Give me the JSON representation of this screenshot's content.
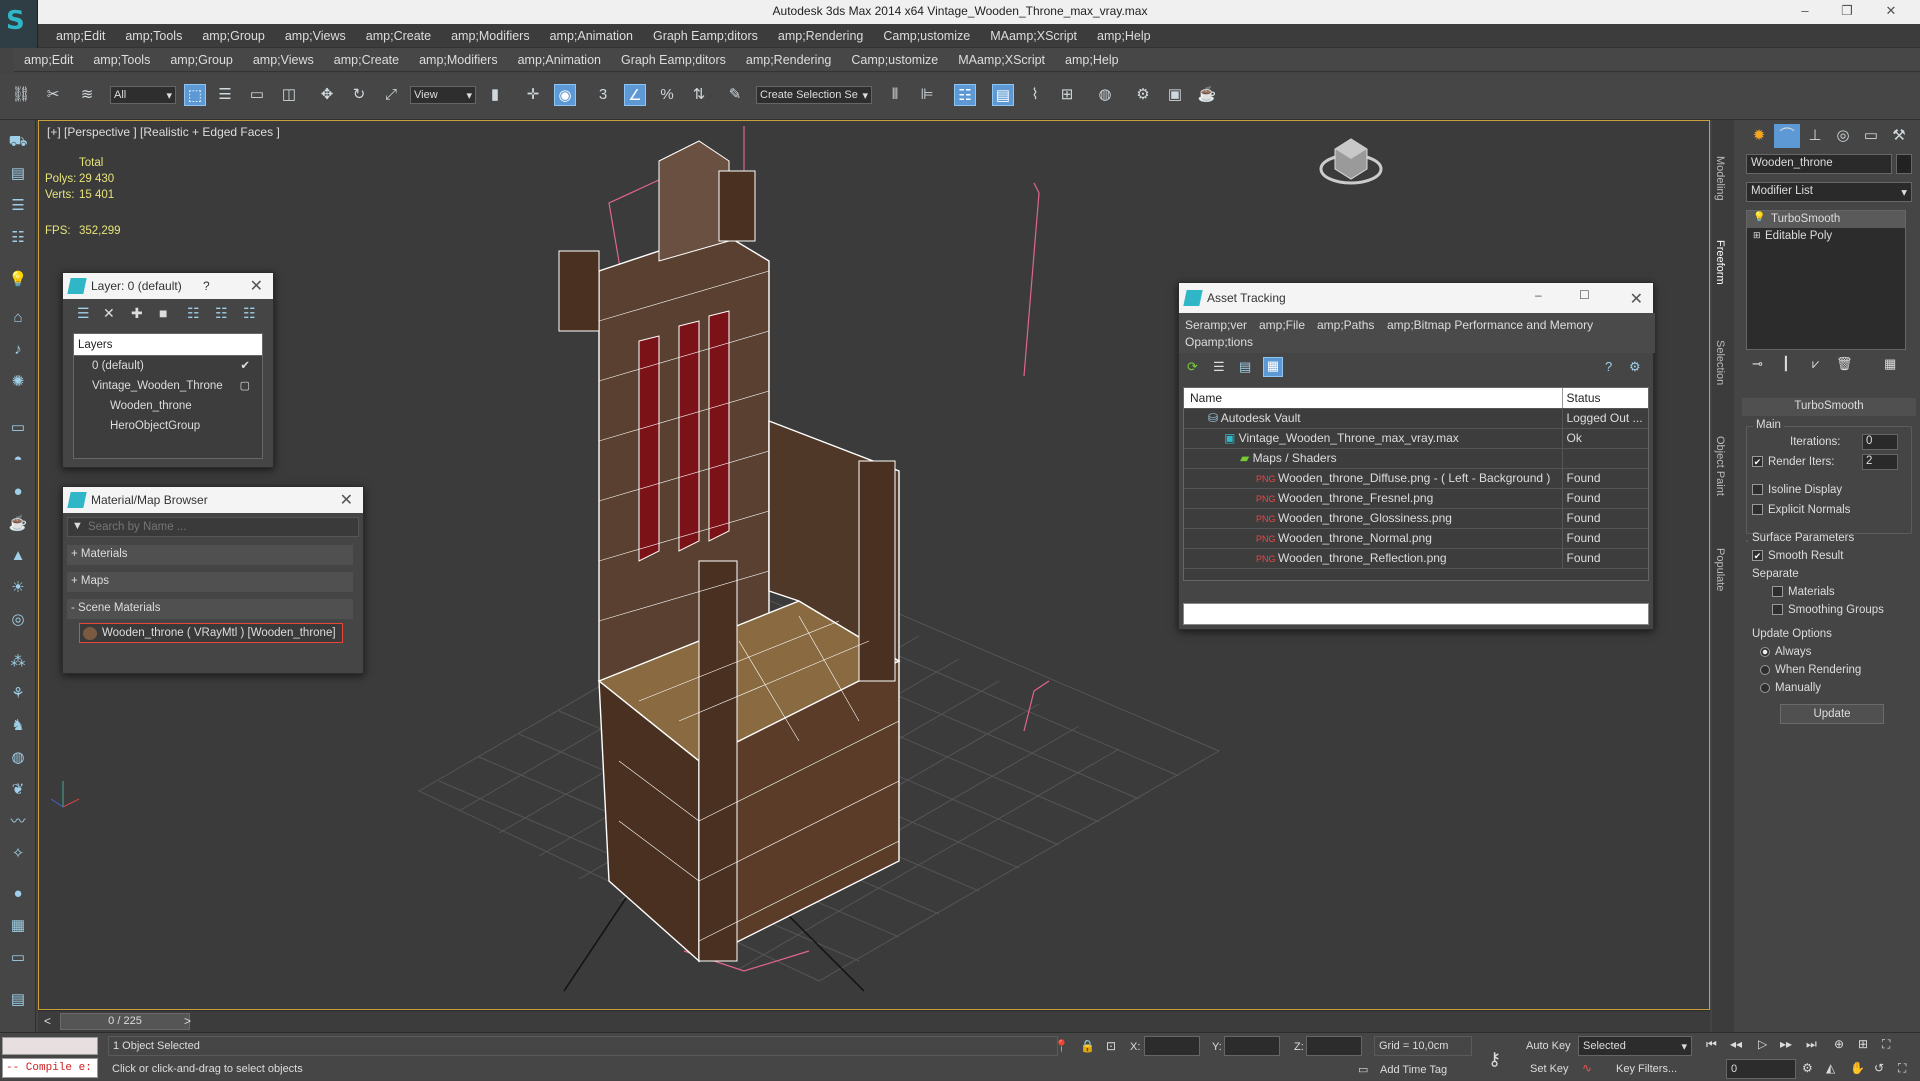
{
  "window": {
    "title": "Autodesk 3ds Max  2014 x64     Vintage_Wooden_Throne_max_vray.max",
    "minimize": "–",
    "maximize": "❐",
    "close": "✕"
  },
  "menu1": [
    "amp;Edit",
    "amp;Tools",
    "amp;Group",
    "amp;Views",
    "amp;Create",
    "amp;Modifiers",
    "amp;Animation",
    "Graph Eamp;ditors",
    "amp;Rendering",
    "Camp;ustomize",
    "MAamp;XScript",
    "amp;Help"
  ],
  "menu2": [
    "amp;Edit",
    "amp;Tools",
    "amp;Group",
    "amp;Views",
    "amp;Create",
    "amp;Modifiers",
    "amp;Animation",
    "Graph Eamp;ditors",
    "amp;Rendering",
    "Camp;ustomize",
    "MAamp;XScript",
    "amp;Help"
  ],
  "toolbar": {
    "selection_filter": "All",
    "reference_coord": "View",
    "named_selection": "Create Selection Se"
  },
  "viewport": {
    "label": "[+] [Perspective ] [Realistic + Edged Faces ]",
    "stats": {
      "total_label": "Total",
      "polys_label": "Polys:",
      "polys": "29 430",
      "verts_label": "Verts:",
      "verts": "15 401",
      "fps_label": "FPS:",
      "fps": "352,299"
    }
  },
  "layer_panel": {
    "title": "Layer: 0 (default)",
    "help": "?",
    "header": "Layers",
    "items": [
      "0 (default)",
      "Vintage_Wooden_Throne",
      "Wooden_throne",
      "HeroObjectGroup"
    ]
  },
  "material_browser": {
    "title": "Material/Map Browser",
    "search_placeholder": "Search by Name ...",
    "groups": [
      "+ Materials",
      "+ Maps",
      "- Scene Materials"
    ],
    "scene_material": "Wooden_throne  ( VRayMtl )  [Wooden_throne]"
  },
  "asset_tracking": {
    "title": "Asset Tracking",
    "menu": [
      "Seramp;ver",
      "amp;File",
      "amp;Paths",
      "amp;Bitmap Performance and Memory"
    ],
    "menu2": [
      "Opamp;tions"
    ],
    "columns": [
      "Name",
      "Status"
    ],
    "rows": [
      {
        "name": "Autodesk Vault",
        "status": "Logged Out ..."
      },
      {
        "name": "Vintage_Wooden_Throne_max_vray.max",
        "status": "Ok"
      },
      {
        "name": "Maps / Shaders",
        "status": ""
      },
      {
        "name": "Wooden_throne_Diffuse.png - ( Left - Background )",
        "status": "Found"
      },
      {
        "name": "Wooden_throne_Fresnel.png",
        "status": "Found"
      },
      {
        "name": "Wooden_throne_Glossiness.png",
        "status": "Found"
      },
      {
        "name": "Wooden_throne_Normal.png",
        "status": "Found"
      },
      {
        "name": "Wooden_throne_Reflection.png",
        "status": "Found"
      }
    ]
  },
  "command_panel": {
    "side_tabs": [
      "Modeling",
      "Freeform",
      "Selection",
      "Object Paint",
      "Populate"
    ],
    "object_name": "Wooden_throne",
    "modifier_list": "Modifier List",
    "stack": [
      "TurboSmooth",
      "Editable Poly"
    ],
    "rollout_title": "TurboSmooth",
    "main_label": "Main",
    "iterations_label": "Iterations:",
    "iterations": "0",
    "render_iters_label": "Render Iters:",
    "render_iters": "2",
    "isoline": "Isoline Display",
    "explicit_normals": "Explicit Normals",
    "surface_params": "Surface Parameters",
    "smooth_result": "Smooth Result",
    "separate": "Separate",
    "materials": "Materials",
    "smoothing_groups": "Smoothing Groups",
    "update_options": "Update Options",
    "always": "Always",
    "when_rendering": "When Rendering",
    "manually": "Manually",
    "update_btn": "Update"
  },
  "timeline": {
    "frame": "0 / 225",
    "prev": "<",
    "next": ">"
  },
  "status": {
    "listener": "-- Compile e:",
    "selected": "1 Object Selected",
    "prompt": "Click or click-and-drag to select objects",
    "x_label": "X:",
    "y_label": "Y:",
    "z_label": "Z:",
    "grid": "Grid = 10,0cm",
    "add_time_tag": "Add Time Tag",
    "auto_key": "Auto Key",
    "set_key": "Set Key",
    "selected_dropdown": "Selected",
    "key_filters": "Key Filters...",
    "frame_field": "0"
  },
  "colors": {
    "accent": "#5d9ad5",
    "viewport_border": "#c8a03c",
    "stats": "#e7e37a",
    "selected_mat": "#e8443a"
  }
}
